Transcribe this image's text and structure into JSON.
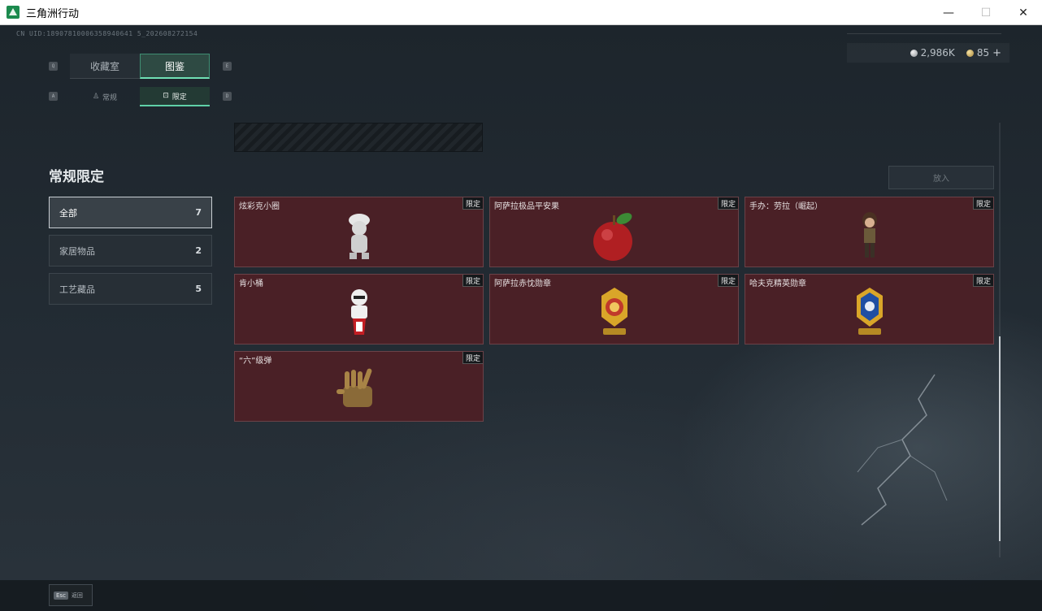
{
  "window": {
    "title": "三角洲行动",
    "minimize": "—",
    "maximize": "☐",
    "close": "✕"
  },
  "header": {
    "uid": "CN UID:18907810006358940641 5_202608272154",
    "silver_amount": "2,986K",
    "gold_amount": "85",
    "add": "+"
  },
  "tabs": {
    "key_left": "Q",
    "key_right": "E",
    "items": [
      {
        "label": "收藏室",
        "active": false
      },
      {
        "label": "图鉴",
        "active": true
      }
    ]
  },
  "subtabs": {
    "key_left": "A",
    "key_right": "D",
    "items": [
      {
        "label": "常规",
        "icon": "trophy-icon",
        "active": false
      },
      {
        "label": "限定",
        "icon": "frame-icon",
        "active": true
      }
    ]
  },
  "sidebar": {
    "title": "常规限定",
    "categories": [
      {
        "label": "全部",
        "count": "7",
        "active": true
      },
      {
        "label": "家居物品",
        "count": "2",
        "active": false
      },
      {
        "label": "工艺藏品",
        "count": "5",
        "active": false
      }
    ]
  },
  "actions": {
    "place": "放入"
  },
  "items": [
    {
      "name": "炫彩克小圈",
      "tag": "限定",
      "icon": "figurine-icon"
    },
    {
      "name": "阿萨拉极品平安果",
      "tag": "限定",
      "icon": "apple-icon"
    },
    {
      "name": "手办：劳拉（崛起）",
      "tag": "限定",
      "icon": "lara-figure-icon"
    },
    {
      "name": "肯小桶",
      "tag": "限定",
      "icon": "bucket-figure-icon"
    },
    {
      "name": "阿萨拉赤忱勋章",
      "tag": "限定",
      "icon": "gold-medal-icon"
    },
    {
      "name": "哈夫克精英勋章",
      "tag": "限定",
      "icon": "blue-medal-icon"
    },
    {
      "name": "“六”级弹",
      "tag": "限定",
      "icon": "bullet-hand-icon"
    }
  ],
  "footer": {
    "esc_key": "Esc",
    "esc_label": "返回"
  },
  "colors": {
    "accent": "#5fd1a8",
    "card_bg": "#4a2026",
    "background": "#1f262c"
  }
}
